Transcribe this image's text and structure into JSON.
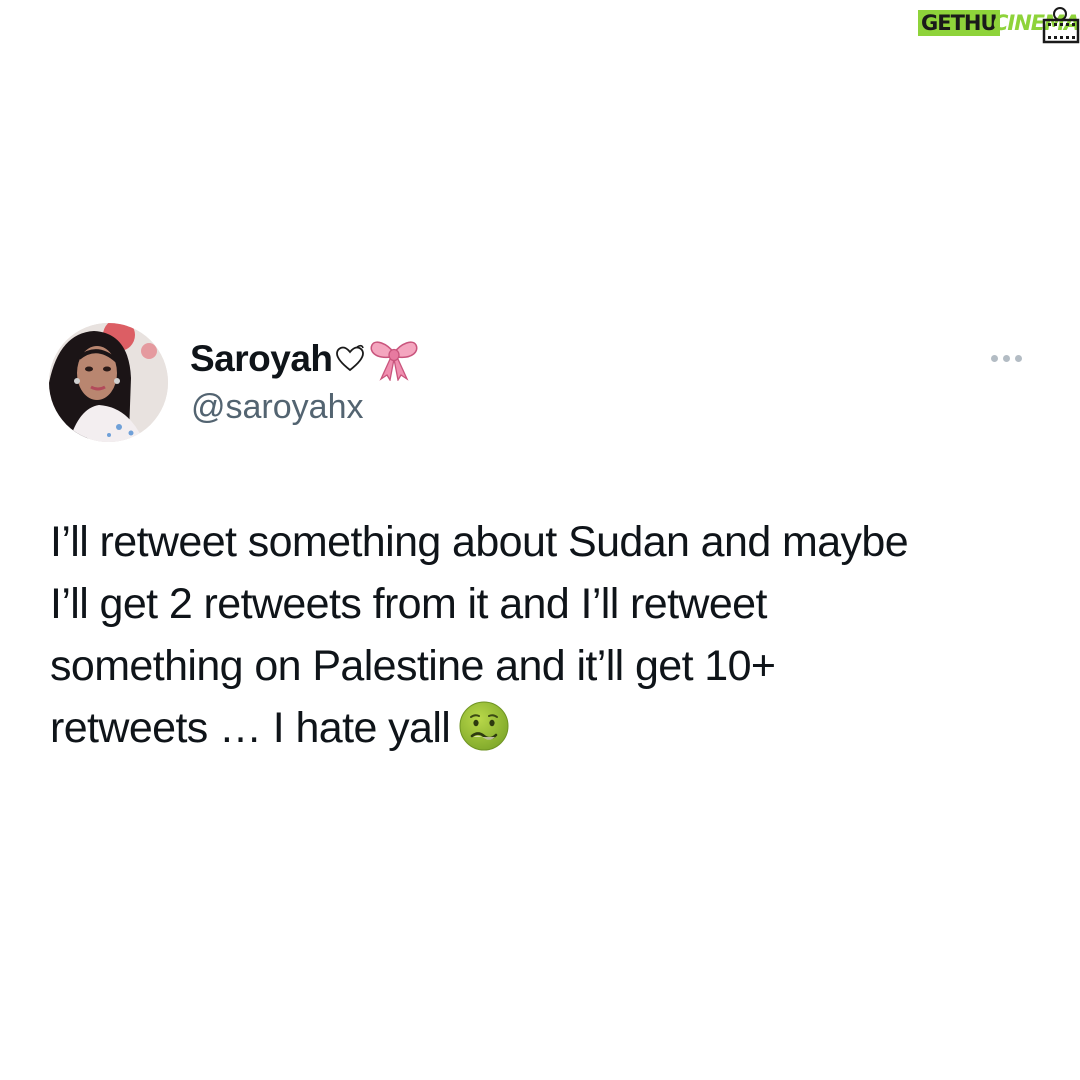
{
  "watermark": {
    "left_text": "GETHU",
    "right_text": "CINEMA",
    "accent_color": "#8ed33a"
  },
  "tweet": {
    "display_name": "Saroyah",
    "name_emojis": [
      "white-heart-icon",
      "ribbon-bow-icon"
    ],
    "handle": "@saroyahx",
    "more_icon": "more-options-icon",
    "text_lines": [
      "I’ll retweet something about Sudan and maybe",
      "I’ll get 2 retweets from it and I’ll retweet",
      "something on Palestine and it’ll get 10+",
      "retweets … I hate yall"
    ],
    "trailing_emoji": "nauseated-face-icon",
    "colors": {
      "text": "#0f1419",
      "secondary": "#536471",
      "more_dots": "#b3bcc4",
      "background": "#ffffff"
    }
  }
}
